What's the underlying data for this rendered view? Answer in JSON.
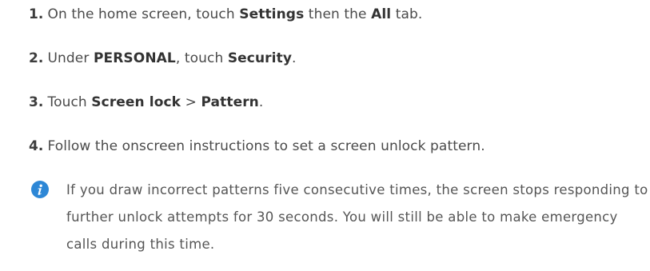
{
  "steps": [
    {
      "number": "1.",
      "parts": [
        "On the home screen, touch ",
        "Settings",
        " then the ",
        "All",
        " tab."
      ]
    },
    {
      "number": "2.",
      "parts": [
        "Under ",
        "PERSONAL",
        ", touch ",
        "Security",
        "."
      ]
    },
    {
      "number": "3.",
      "parts": [
        "Touch ",
        "Screen lock",
        " > ",
        "Pattern",
        "."
      ]
    },
    {
      "number": "4.",
      "text": "Follow the onscreen instructions to set a screen unlock pattern."
    }
  ],
  "note": {
    "icon": "info-icon",
    "text": "If you draw incorrect patterns five consecutive times, the screen stops responding to further unlock attempts for 30 seconds. You will still be able to make emergency calls during this time.",
    "icon_color": "#2d87d6"
  }
}
